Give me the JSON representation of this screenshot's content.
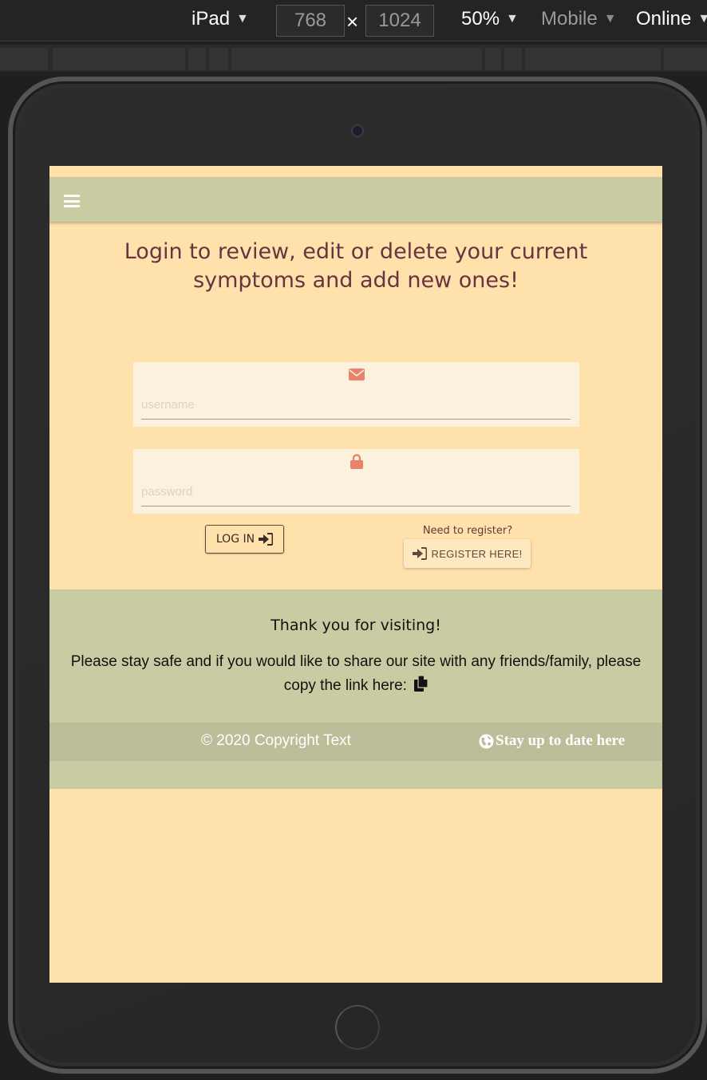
{
  "devtools": {
    "device": "iPad",
    "width": "768",
    "height": "1024",
    "zoom": "50%",
    "throttle": "Mobile",
    "network": "Online",
    "separator": "×"
  },
  "page": {
    "heading": "Login to review, edit or delete your current symptoms and add new ones!",
    "form": {
      "username_placeholder": "username",
      "password_placeholder": "password",
      "login_label": "LOG IN",
      "need_register": "Need to register?",
      "register_label": "REGISTER HERE!"
    },
    "footer": {
      "thanks": "Thank you for visiting!",
      "share": "Please stay safe and if you would like to share our site with any friends/family, please copy the link here:",
      "copyright": "© 2020 Copyright Text",
      "stay": "Stay up to date here"
    }
  },
  "colors": {
    "background": "#ffe1ab",
    "navbar": "#c9cba3",
    "footer_bar": "#bcbd99",
    "heading": "#6a3341",
    "icon_accent": "#e8826a"
  },
  "icons": [
    "hamburger-menu-icon",
    "envelope-icon",
    "lock-icon",
    "sign-in-icon",
    "copy-icon",
    "globe-icon",
    "caret-down-icon"
  ]
}
